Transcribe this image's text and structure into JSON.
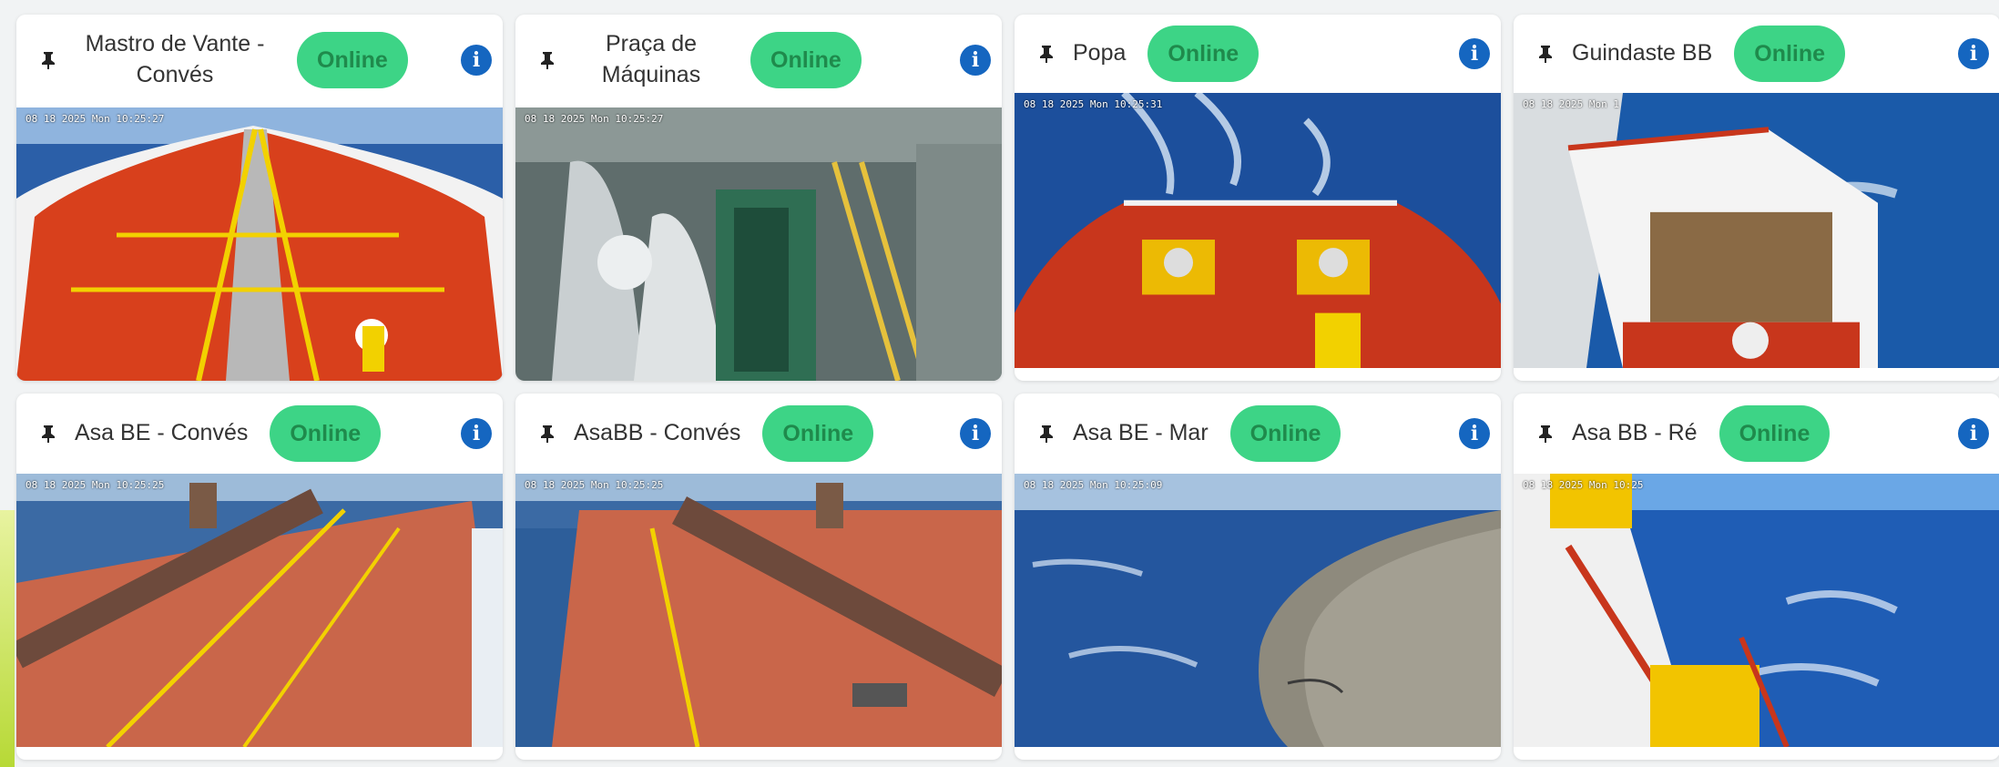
{
  "cameras": [
    {
      "name": "Mastro de Vante - Convés",
      "status": "Online",
      "timestamp": "08 18 2025 Mon 10:25:27",
      "scene": "bow-deck"
    },
    {
      "name": "Praça de Máquinas",
      "status": "Online",
      "timestamp": "08 18 2025 Mon 10:25:27",
      "scene": "engine-room"
    },
    {
      "name": "Popa",
      "status": "Online",
      "timestamp": "08 18 2025 Mon 10:25:31",
      "scene": "stern"
    },
    {
      "name": "Guindaste BB",
      "status": "Online",
      "timestamp": "08 18 2025 Mon 1",
      "scene": "crane"
    },
    {
      "name": "Asa BE - Convés",
      "status": "Online",
      "timestamp": "08 18 2025 Mon 10:25:25",
      "scene": "wing-deck"
    },
    {
      "name": "AsaBB - Convés",
      "status": "Online",
      "timestamp": "08 18 2025 Mon 10:25:25",
      "scene": "wing-deck-2"
    },
    {
      "name": "Asa BE - Mar",
      "status": "Online",
      "timestamp": "08 18 2025 Mon 10:25:09",
      "scene": "sea"
    },
    {
      "name": "Asa BB - Ré",
      "status": "Online",
      "timestamp": "08 18 2025 Mon 10:25",
      "scene": "aft-side"
    }
  ],
  "icons": {
    "pin": "pin-icon",
    "info": "info-icon"
  },
  "colors": {
    "online_bg": "#3dd486",
    "online_text": "#1f8a4c",
    "info": "#1566c0",
    "deck": "#c8361c",
    "sea": "#1c4f9c"
  }
}
